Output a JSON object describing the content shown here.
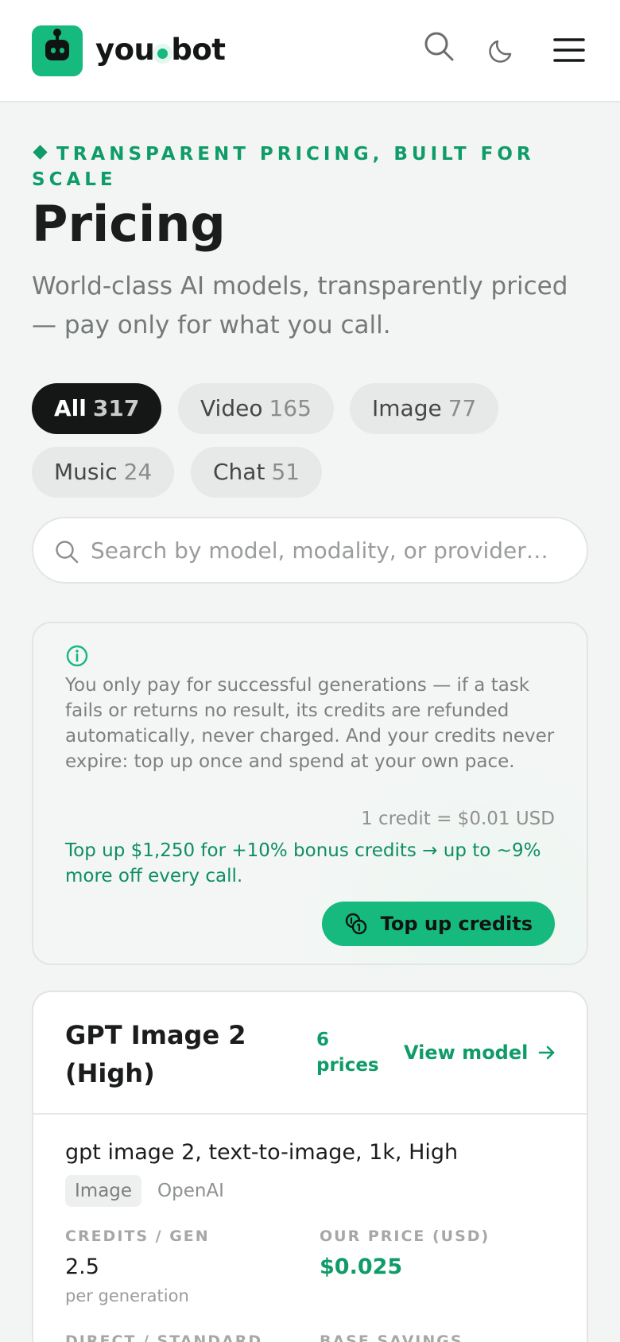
{
  "header": {
    "brand_left": "you",
    "brand_right": "bot",
    "icons": [
      "robot-logo-icon",
      "search-icon",
      "moon-icon",
      "menu-icon"
    ]
  },
  "hero": {
    "eyebrow": "TRANSPARENT PRICING, BUILT FOR SCALE",
    "title": "Pricing",
    "subtitle": "World-class AI models, transparently priced — pay only for what you call."
  },
  "filters": [
    {
      "label": "All",
      "count": "317",
      "active": true
    },
    {
      "label": "Video",
      "count": "165",
      "active": false
    },
    {
      "label": "Image",
      "count": "77",
      "active": false
    },
    {
      "label": "Music",
      "count": "24",
      "active": false
    },
    {
      "label": "Chat",
      "count": "51",
      "active": false
    }
  ],
  "search": {
    "placeholder": "Search by model, modality, or provider…"
  },
  "info": {
    "note": "You only pay for successful generations — if a task fails or returns no result, its credits are refunded automatically, never charged. And your credits never expire: top up once and spend at your own pace.",
    "rate": "1 credit = $0.01 USD",
    "bonus": "Top up $1,250 for +10% bonus credits → up to ~9% more off every call.",
    "topup_label": "Top up credits"
  },
  "model": {
    "title": "GPT Image 2 (High)",
    "price_count": "6 prices",
    "view_label": "View model",
    "variant": "gpt image 2, text-to-image, 1k, High",
    "tag": "Image",
    "provider": "OpenAI",
    "credits_label": "CREDITS / GEN",
    "credits_value": "2.5",
    "credits_sub": "per generation",
    "price_label": "OUR PRICE (USD)",
    "price_value": "$0.025",
    "direct_label": "DIRECT / STANDARD",
    "savings_label": "BASE SAVINGS"
  },
  "colors": {
    "accent": "#16b97e",
    "accent_text": "#0f9c69",
    "background": "#f3f5f4"
  }
}
